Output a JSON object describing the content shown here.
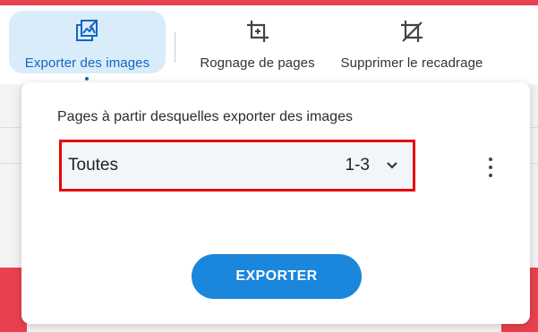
{
  "toolbar": {
    "export_images": {
      "label": "Exporter des images",
      "icon": "export-images-icon",
      "active": true
    },
    "crop_pages": {
      "label": "Rognage de pages",
      "icon": "crop-icon"
    },
    "remove_crop": {
      "label": "Supprimer le recadrage",
      "icon": "crop-off-icon"
    }
  },
  "panel": {
    "title": "Pages à partir desquelles exporter des images",
    "select": {
      "value": "Toutes",
      "range": "1-3"
    },
    "export_button": "EXPORTER"
  },
  "colors": {
    "accent": "#1a86dc",
    "active_tab_bg": "#d9ecfa",
    "active_tab_text": "#1565c0",
    "highlight_border": "#e8000b",
    "brand_red": "#e8424f"
  }
}
